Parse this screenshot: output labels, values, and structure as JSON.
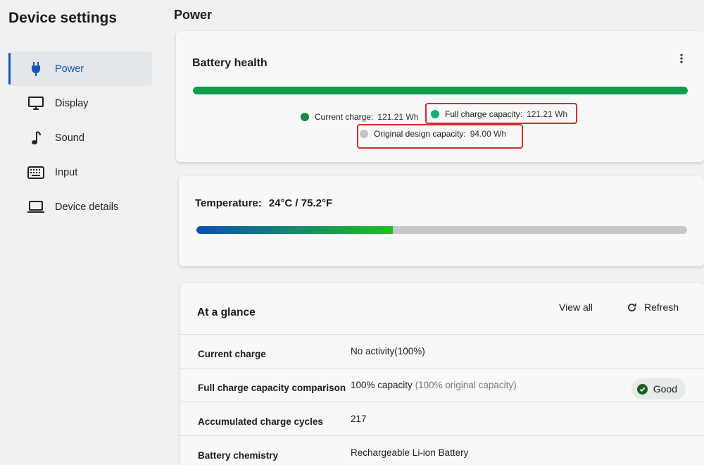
{
  "app": {
    "title": "Device settings"
  },
  "sidebar": {
    "items": [
      {
        "label": "Power",
        "icon": "plug-icon",
        "active": true
      },
      {
        "label": "Display",
        "icon": "monitor-icon",
        "active": false
      },
      {
        "label": "Sound",
        "icon": "music-note-icon",
        "active": false
      },
      {
        "label": "Input",
        "icon": "keyboard-icon",
        "active": false
      },
      {
        "label": "Device details",
        "icon": "laptop-icon",
        "active": false
      }
    ]
  },
  "page": {
    "title": "Power"
  },
  "battery": {
    "title": "Battery health",
    "bar_fraction": 1.0,
    "bar_color": "#0f9d4e",
    "legend": {
      "current_charge": {
        "label": "Current charge:",
        "value": "121.21 Wh",
        "color": "#0e8a43"
      },
      "full_capacity": {
        "label": "Full charge capacity:",
        "value": "121.21 Wh",
        "color": "#16b17a"
      },
      "design_capacity": {
        "label": "Original design capacity:",
        "value": "94.00 Wh",
        "color": "#c0c5cb"
      }
    },
    "highlight_color": "#d42c2c"
  },
  "temperature": {
    "label": "Temperature:",
    "value": "24°C / 75.2°F",
    "bar_fraction": 0.4,
    "gradient_start": "#0a4fb5",
    "gradient_end": "#20c020",
    "track_color": "#c3c8cc"
  },
  "glance": {
    "title": "At a glance",
    "view_all": "View all",
    "refresh": "Refresh",
    "rows": [
      {
        "label": "Current charge",
        "value": "No activity(100%)",
        "note": ""
      },
      {
        "label": "Full charge capacity comparison",
        "value": "100% capacity",
        "note": "(100% original capacity)",
        "badge": "Good"
      },
      {
        "label": "Accumulated charge cycles",
        "value": "217",
        "note": ""
      },
      {
        "label": "Battery chemistry",
        "value": "Rechargeable Li-ion Battery",
        "note": ""
      }
    ]
  },
  "colors": {
    "accent": "#1456b8",
    "good": "#1b5e20"
  }
}
